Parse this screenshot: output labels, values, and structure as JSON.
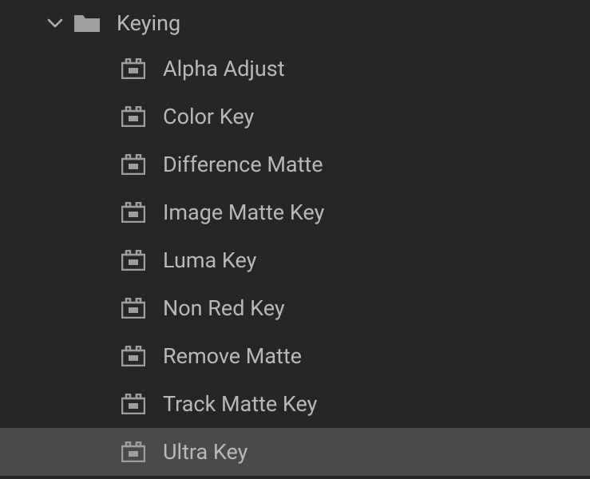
{
  "folder": {
    "label": "Keying",
    "expanded": true
  },
  "effects": [
    {
      "label": "Alpha Adjust",
      "selected": false
    },
    {
      "label": "Color Key",
      "selected": false
    },
    {
      "label": "Difference Matte",
      "selected": false
    },
    {
      "label": "Image Matte Key",
      "selected": false
    },
    {
      "label": "Luma Key",
      "selected": false
    },
    {
      "label": "Non Red Key",
      "selected": false
    },
    {
      "label": "Remove Matte",
      "selected": false
    },
    {
      "label": "Track Matte Key",
      "selected": false
    },
    {
      "label": "Ultra Key",
      "selected": true
    }
  ]
}
